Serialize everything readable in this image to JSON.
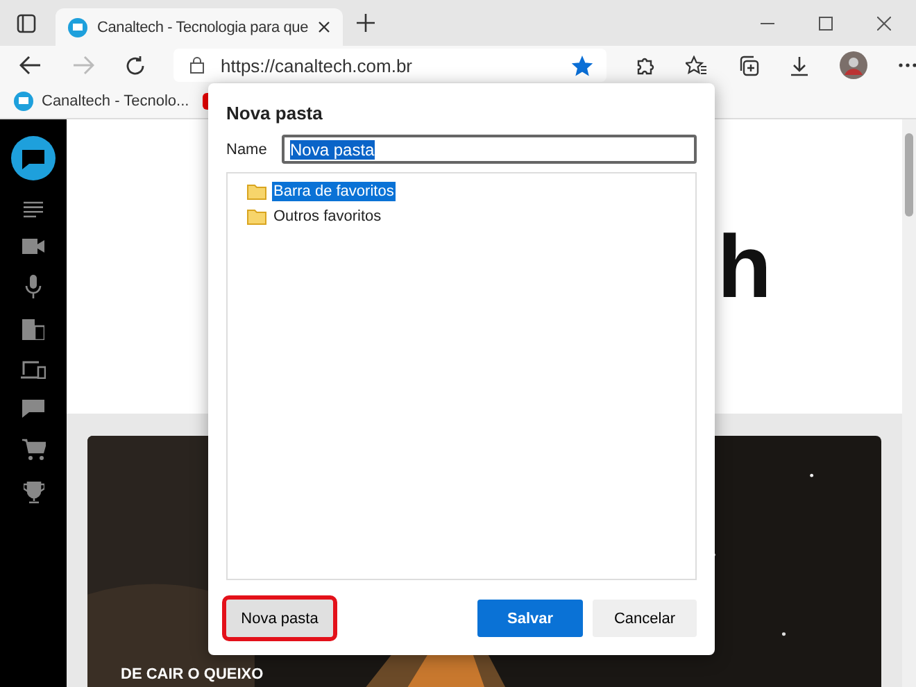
{
  "tabs": [
    {
      "title": "Canaltech - Tecnologia para que",
      "selected": true
    }
  ],
  "address_bar": {
    "url": "https://canaltech.com.br",
    "bookmarked": true
  },
  "bookmarks": [
    {
      "label": "Canaltech - Tecnolo..."
    }
  ],
  "page": {
    "logo_fragment": "h",
    "story_caption": "DE CAIR O QUEIXO"
  },
  "dialog": {
    "title": "Nova pasta",
    "name_label": "Name",
    "name_value": "Nova pasta",
    "name_selected": true,
    "folders": [
      {
        "label": "Barra de favoritos",
        "selected": true
      },
      {
        "label": "Outros favoritos",
        "selected": false
      }
    ],
    "new_folder_button": {
      "label": "Nova pasta",
      "highlighted": true
    },
    "save_button": "Salvar",
    "cancel_button": "Cancelar"
  }
}
